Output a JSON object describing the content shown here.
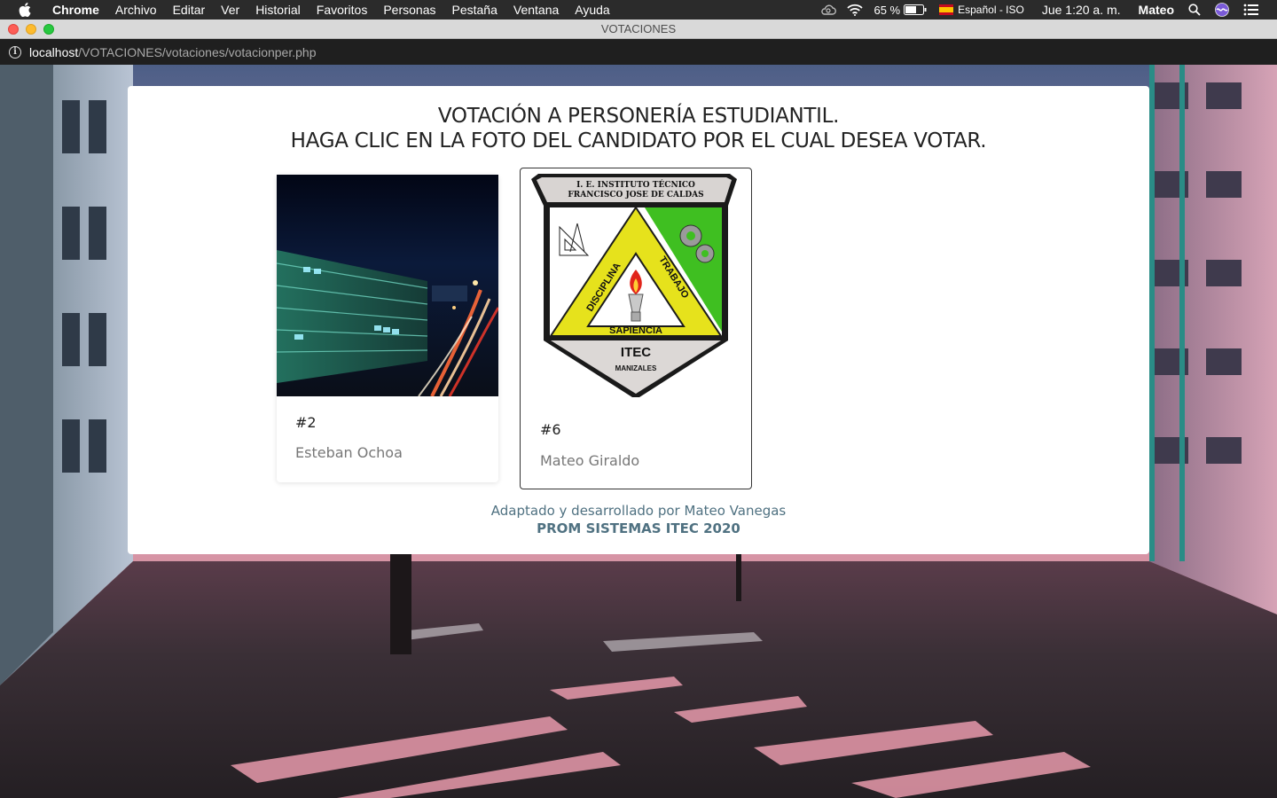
{
  "menubar": {
    "app_name": "Chrome",
    "items": [
      "Archivo",
      "Editar",
      "Ver",
      "Historial",
      "Favoritos",
      "Personas",
      "Pestaña",
      "Ventana",
      "Ayuda"
    ],
    "battery": "65 %",
    "input_source": "Español - ISO",
    "clock": "Jue 1:20 a. m.",
    "user": "Mateo"
  },
  "window": {
    "title": "VOTACIONES"
  },
  "address": {
    "host": "localhost",
    "path": "/VOTACIONES/votaciones/votacionper.php"
  },
  "page": {
    "heading_line1": "VOTACIÓN A PERSONERÍA ESTUDIANTIL.",
    "heading_line2": "HAGA CLIC EN LA FOTO DEL CANDIDATO POR EL CUAL DESEA VOTAR.",
    "candidates": [
      {
        "number": "#2",
        "name": "Esteban Ochoa"
      },
      {
        "number": "#6",
        "name": "Mateo Giraldo"
      }
    ],
    "crest": {
      "banner_line1": "I. E. INSTITUTO TÉCNICO",
      "banner_line2": "FRANCISCO JOSE DE CALDAS",
      "left_word": "DISCIPLINA",
      "right_word": "TRABAJO",
      "bottom_word": "SAPIENCIA",
      "acronym": "ITEC",
      "city": "MANIZALES"
    },
    "footer_credit": "Adaptado y desarrollado por Mateo Vanegas",
    "footer_prom": "PROM SISTEMAS ITEC 2020"
  },
  "colors": {
    "accent_text": "#4f7181",
    "crest_yellow": "#e6e21c",
    "crest_green": "#3fbf21"
  }
}
